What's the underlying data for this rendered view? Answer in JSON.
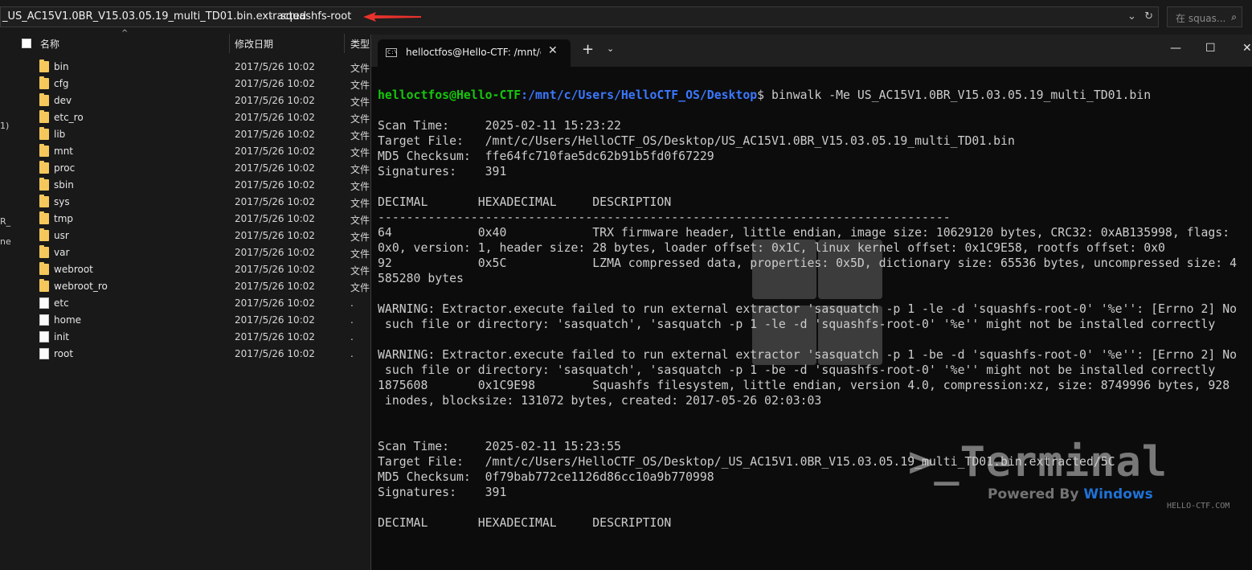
{
  "explorer": {
    "breadcrumb": [
      "_US_AC15V1.0BR_V15.03.05.19_multi_TD01.bin.extracted",
      "squashfs-root"
    ],
    "search_placeholder": "在 squas...",
    "columns": {
      "name": "名称",
      "date": "修改日期",
      "type": "类型"
    },
    "left_glyphs": [
      "1)",
      "R_",
      "ne"
    ],
    "files": [
      {
        "name": "bin",
        "kind": "folder",
        "date": "2017/5/26 10:02",
        "type": "文件"
      },
      {
        "name": "cfg",
        "kind": "folder",
        "date": "2017/5/26 10:02",
        "type": "文件"
      },
      {
        "name": "dev",
        "kind": "folder",
        "date": "2017/5/26 10:02",
        "type": "文件"
      },
      {
        "name": "etc_ro",
        "kind": "folder",
        "date": "2017/5/26 10:02",
        "type": "文件"
      },
      {
        "name": "lib",
        "kind": "folder",
        "date": "2017/5/26 10:02",
        "type": "文件"
      },
      {
        "name": "mnt",
        "kind": "folder",
        "date": "2017/5/26 10:02",
        "type": "文件"
      },
      {
        "name": "proc",
        "kind": "folder",
        "date": "2017/5/26 10:02",
        "type": "文件"
      },
      {
        "name": "sbin",
        "kind": "folder",
        "date": "2017/5/26 10:02",
        "type": "文件"
      },
      {
        "name": "sys",
        "kind": "folder",
        "date": "2017/5/26 10:02",
        "type": "文件"
      },
      {
        "name": "tmp",
        "kind": "folder",
        "date": "2017/5/26 10:02",
        "type": "文件"
      },
      {
        "name": "usr",
        "kind": "folder",
        "date": "2017/5/26 10:02",
        "type": "文件"
      },
      {
        "name": "var",
        "kind": "folder",
        "date": "2017/5/26 10:02",
        "type": "文件"
      },
      {
        "name": "webroot",
        "kind": "folder",
        "date": "2017/5/26 10:02",
        "type": "文件"
      },
      {
        "name": "webroot_ro",
        "kind": "folder",
        "date": "2017/5/26 10:02",
        "type": "文件"
      },
      {
        "name": "etc",
        "kind": "file",
        "date": "2017/5/26 10:02",
        "type": "."
      },
      {
        "name": "home",
        "kind": "file",
        "date": "2017/5/26 10:02",
        "type": "."
      },
      {
        "name": "init",
        "kind": "file",
        "date": "2017/5/26 10:02",
        "type": "."
      },
      {
        "name": "root",
        "kind": "file",
        "date": "2017/5/26 10:02",
        "type": "."
      }
    ]
  },
  "terminal": {
    "tab_title": "helloctfos@Hello-CTF: /mnt/c/",
    "prompt_user": "helloctfos@Hello-CTF",
    "prompt_path": ":/mnt/c/Users/HelloCTF_OS/Desktop",
    "command": "$ binwalk -Me US_AC15V1.0BR_V15.03.05.19_multi_TD01.bin",
    "output": [
      "",
      "Scan Time:     2025-02-11 15:23:22",
      "Target File:   /mnt/c/Users/HelloCTF_OS/Desktop/US_AC15V1.0BR_V15.03.05.19_multi_TD01.bin",
      "MD5 Checksum:  ffe64fc710fae5dc62b91b5fd0f67229",
      "Signatures:    391",
      "",
      "DECIMAL       HEXADECIMAL     DESCRIPTION",
      "--------------------------------------------------------------------------------",
      "64            0x40            TRX firmware header, little endian, image size: 10629120 bytes, CRC32: 0xAB135998, flags:",
      "0x0, version: 1, header size: 28 bytes, loader offset: 0x1C, linux kernel offset: 0x1C9E58, rootfs offset: 0x0",
      "92            0x5C            LZMA compressed data, properties: 0x5D, dictionary size: 65536 bytes, uncompressed size: 4",
      "585280 bytes",
      "",
      "WARNING: Extractor.execute failed to run external extractor 'sasquatch -p 1 -le -d 'squashfs-root-0' '%e'': [Errno 2] No",
      " such file or directory: 'sasquatch', 'sasquatch -p 1 -le -d 'squashfs-root-0' '%e'' might not be installed correctly",
      "",
      "WARNING: Extractor.execute failed to run external extractor 'sasquatch -p 1 -be -d 'squashfs-root-0' '%e'': [Errno 2] No",
      " such file or directory: 'sasquatch', 'sasquatch -p 1 -be -d 'squashfs-root-0' '%e'' might not be installed correctly",
      "1875608       0x1C9E98        Squashfs filesystem, little endian, version 4.0, compression:xz, size: 8749996 bytes, 928",
      " inodes, blocksize: 131072 bytes, created: 2017-05-26 02:03:03",
      "",
      "",
      "Scan Time:     2025-02-11 15:23:55",
      "Target File:   /mnt/c/Users/HelloCTF_OS/Desktop/_US_AC15V1.0BR_V15.03.05.19_multi_TD01.bin.extracted/5C",
      "MD5 Checksum:  0f79bab772ce1126d86cc10a9b770998",
      "Signatures:    391",
      "",
      "DECIMAL       HEXADECIMAL     DESCRIPTION"
    ]
  },
  "watermark": {
    "title": ">_Terminal",
    "powered": "Powered By ",
    "brand": "Windows",
    "site": "HELLO-CTF.COM"
  },
  "colors": {
    "accent_red": "#e8322c",
    "prompt_green": "#16c60c",
    "prompt_blue": "#3b78ff",
    "folder_yellow": "#f5c85c"
  }
}
